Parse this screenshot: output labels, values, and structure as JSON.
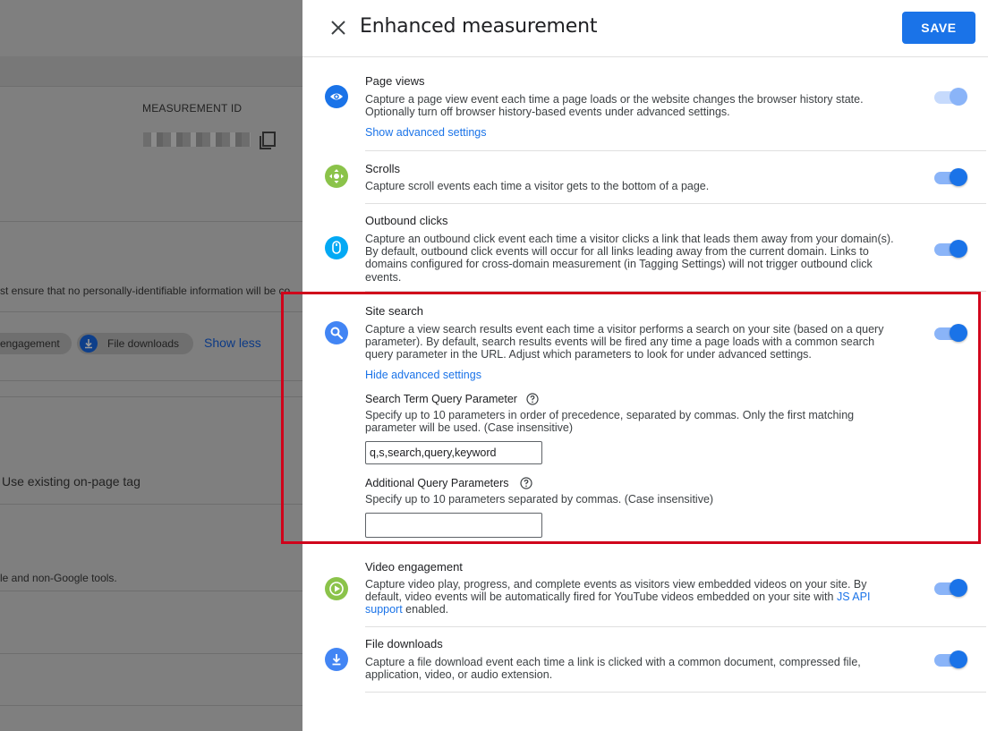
{
  "background": {
    "measurement_id_label": "MEASUREMENT ID",
    "privacy_notice": "st ensure that no personally-identifiable information will be co",
    "chip_engagement": "engagement",
    "chip_file_downloads": "File downloads",
    "show_less": "Show less",
    "existing_tag": "Use existing on-page tag",
    "tools_text": "le and non-Google tools."
  },
  "drawer": {
    "title": "Enhanced measurement",
    "save_label": "SAVE",
    "items": [
      {
        "title": "Page views",
        "desc": "Capture a page view event each time a page loads or the website changes the browser history state. Optionally turn off browser history-based events under advanced settings.",
        "link": "Show advanced settings",
        "enabled": true,
        "icon": "eye-icon",
        "icon_color": "#1a73e8"
      },
      {
        "title": "Scrolls",
        "desc": "Capture scroll events each time a visitor gets to the bottom of a page.",
        "enabled": true,
        "icon": "scroll-icon",
        "icon_color": "#8bc34a"
      },
      {
        "title": "Outbound clicks",
        "desc": "Capture an outbound click event each time a visitor clicks a link that leads them away from your domain(s). By default, outbound click events will occur for all links leading away from the current domain. Links to domains configured for cross-domain measurement (in Tagging Settings) will not trigger outbound click events.",
        "enabled": true,
        "icon": "mouse-icon",
        "icon_color": "#03a9f4"
      },
      {
        "title": "Site search",
        "desc": "Capture a view search results event each time a visitor performs a search on your site (based on a query parameter). By default, search results events will be fired any time a page loads with a common search query parameter in the URL. Adjust which parameters to look for under advanced settings.",
        "link": "Hide advanced settings",
        "enabled": true,
        "icon": "search-icon",
        "icon_color": "#4285f4",
        "search_term_label": "Search Term Query Parameter",
        "search_term_help": "Specify up to 10 parameters in order of precedence, separated by commas. Only the first matching parameter will be used. (Case insensitive)",
        "search_term_value": "q,s,search,query,keyword",
        "additional_label": "Additional Query Parameters",
        "additional_help": "Specify up to 10 parameters separated by commas. (Case insensitive)",
        "additional_value": ""
      },
      {
        "title": "Video engagement",
        "desc_before": "Capture video play, progress, and complete events as visitors view embedded videos on your site. By default, video events will be automatically fired for YouTube videos embedded on your site with ",
        "desc_link": "JS API support",
        "desc_after": " enabled.",
        "enabled": true,
        "icon": "play-icon",
        "icon_color": "#8bc34a"
      },
      {
        "title": "File downloads",
        "desc": "Capture a file download event each time a link is clicked with a common document, compressed file, application, video, or audio extension.",
        "enabled": true,
        "icon": "download-icon",
        "icon_color": "#4285f4"
      }
    ]
  },
  "colors": {
    "accent": "#1a73e8",
    "highlight_box": "#d0021b"
  }
}
